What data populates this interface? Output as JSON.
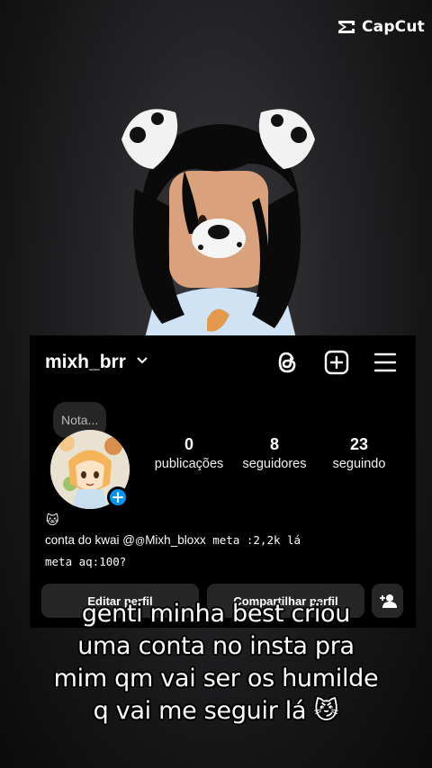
{
  "watermark": {
    "brand": "CapCut",
    "icon": "capcut-logo-icon"
  },
  "profile": {
    "username": "mixh_brr",
    "note_placeholder": "Nota...",
    "stats": [
      {
        "value": "0",
        "label": "publicações"
      },
      {
        "value": "8",
        "label": "seguidores"
      },
      {
        "value": "23",
        "label": "seguindo"
      }
    ],
    "bio": {
      "emoji": "🐱",
      "line1_text": "conta do kwai @",
      "line1_handle": "Mixh_bloxx",
      "line1_mono": " meta :2,2k lá",
      "line2": "meta aq:100?"
    },
    "buttons": {
      "edit": "Editar perfil",
      "share": "Compartilhar perfil"
    },
    "icons": {
      "header": [
        "chevron-down-icon",
        "threads-icon",
        "add-post-icon",
        "menu-icon"
      ],
      "add_story": "plus-icon",
      "add_friend": "add-user-icon"
    },
    "colors": {
      "accent_blue": "#0095f6",
      "button_bg": "#262626"
    }
  },
  "caption": {
    "lines": [
      "genti minha best criou",
      "uma conta no insta pra",
      "mim qm vai ser os humilde",
      "q vai me seguir lá 😼"
    ]
  }
}
